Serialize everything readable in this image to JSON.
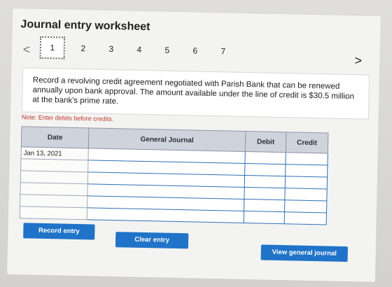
{
  "title": "Journal entry worksheet",
  "nav": {
    "prev_symbol": "<",
    "next_symbol": ">",
    "tabs": [
      "1",
      "2",
      "3",
      "4",
      "5",
      "6",
      "7"
    ],
    "active_tab": "1"
  },
  "instruction": "Record a revolving credit agreement negotiated with Parish Bank that can be renewed annually upon bank approval. The amount available under the line of credit is $30.5 million at the bank's prime rate.",
  "note": "Note: Enter debits before credits.",
  "table": {
    "headers": {
      "date": "Date",
      "journal": "General Journal",
      "debit": "Debit",
      "credit": "Credit"
    },
    "rows": [
      {
        "date": "Jan 13, 2021",
        "journal": "",
        "debit": "",
        "credit": ""
      },
      {
        "date": "",
        "journal": "",
        "debit": "",
        "credit": ""
      },
      {
        "date": "",
        "journal": "",
        "debit": "",
        "credit": ""
      },
      {
        "date": "",
        "journal": "",
        "debit": "",
        "credit": ""
      },
      {
        "date": "",
        "journal": "",
        "debit": "",
        "credit": ""
      },
      {
        "date": "",
        "journal": "",
        "debit": "",
        "credit": ""
      }
    ]
  },
  "buttons": {
    "record": "Record entry",
    "clear": "Clear entry",
    "view": "View general journal"
  },
  "colors": {
    "button_blue": "#1f73c8",
    "header_bg": "#cfd3db",
    "note_red": "#c0392b"
  }
}
